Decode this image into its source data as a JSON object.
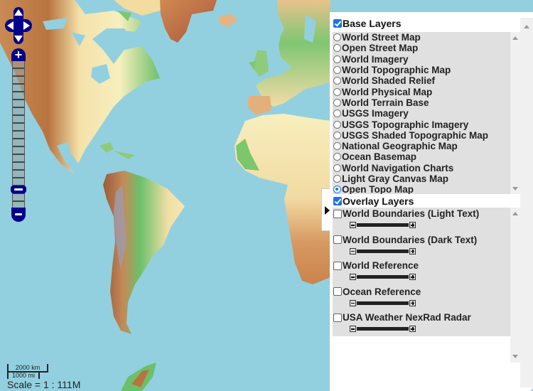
{
  "map": {
    "basemap": "Open Topo Map",
    "ocean_color": "#92d0e0"
  },
  "controls": {
    "pan": [
      "pan-up",
      "pan-left",
      "pan-right",
      "pan-down"
    ],
    "zoom_in_label": "+",
    "zoom_out_label": "−",
    "zoom_level_fraction": 0.15
  },
  "scale": {
    "km_label": "2000 km",
    "mi_label": "1000 mi",
    "ratio_text": "Scale = 1 : 111M"
  },
  "layer_switcher": {
    "base_header": "Base Layers",
    "base_checked": true,
    "base_layers": [
      {
        "label": "World Street Map",
        "selected": false
      },
      {
        "label": "Open Street Map",
        "selected": false
      },
      {
        "label": "World Imagery",
        "selected": false
      },
      {
        "label": "World Topographic Map",
        "selected": false
      },
      {
        "label": "World Shaded Relief",
        "selected": false
      },
      {
        "label": "World Physical Map",
        "selected": false
      },
      {
        "label": "World Terrain Base",
        "selected": false
      },
      {
        "label": "USGS Imagery",
        "selected": false
      },
      {
        "label": "USGS Topographic Imagery",
        "selected": false
      },
      {
        "label": "USGS Shaded Topographic Map",
        "selected": false
      },
      {
        "label": "National Geographic Map",
        "selected": false
      },
      {
        "label": "Ocean Basemap",
        "selected": false
      },
      {
        "label": "World Navigation Charts",
        "selected": false
      },
      {
        "label": "Light Gray Canvas Map",
        "selected": false
      },
      {
        "label": "Open Topo Map",
        "selected": true
      }
    ],
    "overlay_header": "Overlay Layers",
    "overlay_checked": true,
    "overlay_layers": [
      {
        "label": "World Boundaries (Light Text)",
        "checked": false
      },
      {
        "label": "World Boundaries (Dark Text)",
        "checked": false
      },
      {
        "label": "World Reference",
        "checked": false
      },
      {
        "label": "Ocean Reference",
        "checked": false
      },
      {
        "label": "USA Weather NexRad Radar",
        "checked": false
      }
    ]
  }
}
